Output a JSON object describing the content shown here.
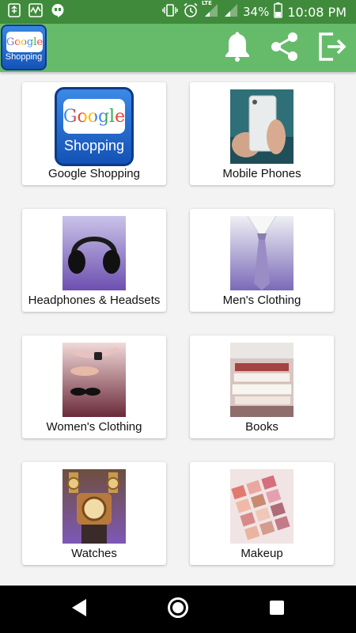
{
  "status_bar": {
    "battery": "34%",
    "time": "10:08 PM",
    "network": "LTE"
  },
  "app_bar": {
    "logo_word": "Google",
    "logo_sub": "Shopping"
  },
  "categories": [
    {
      "label": "Google Shopping"
    },
    {
      "label": "Mobile Phones"
    },
    {
      "label": "Headphones & Headsets"
    },
    {
      "label": "Men's Clothing"
    },
    {
      "label": "Women's Clothing"
    },
    {
      "label": "Books"
    },
    {
      "label": "Watches"
    },
    {
      "label": "Makeup"
    }
  ],
  "colors": {
    "status_bar": "#3f8b3b",
    "app_bar": "#66bb6a",
    "background": "#f3f3f3",
    "nav_bar": "#000000"
  }
}
